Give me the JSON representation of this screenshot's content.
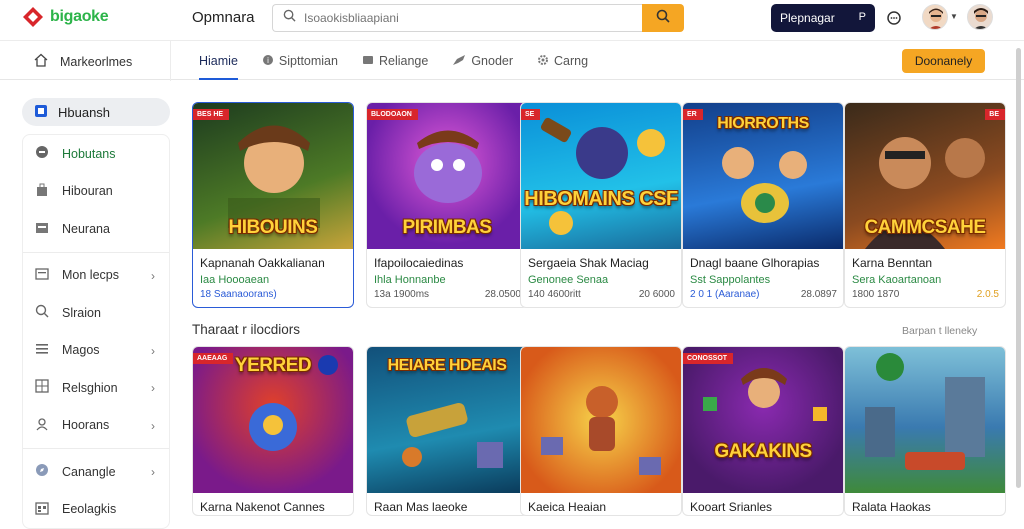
{
  "app": {
    "logo_text": "bigaoke",
    "title": "Opmnara"
  },
  "search": {
    "placeholder": "Isoaokisbliaapiani"
  },
  "header": {
    "promo_label": "Plepnagar",
    "promo_suffix": "P"
  },
  "nav": {
    "home_label": "Markeorlmes",
    "tabs": [
      {
        "label": "Hiamie",
        "icon": "none"
      },
      {
        "label": "Sipttomian",
        "icon": "circle-icon"
      },
      {
        "label": "Reliange",
        "icon": "square-icon"
      },
      {
        "label": "Gnoder",
        "icon": "hand-icon"
      },
      {
        "label": "Carng",
        "icon": "gear-icon"
      }
    ],
    "cta_label": "Doonanely"
  },
  "sidebar": {
    "head_label": "Hbuansh",
    "items": [
      {
        "label": "Hobutans",
        "icon": "gamepad-icon",
        "chevron": false
      },
      {
        "label": "Hibouran",
        "icon": "bag-icon",
        "chevron": false
      },
      {
        "label": "Neurana",
        "icon": "store-icon",
        "chevron": false
      },
      {
        "label": "Mon lecps",
        "icon": "image-icon",
        "chevron": true
      },
      {
        "label": "Slraion",
        "icon": "search-icon",
        "chevron": false
      },
      {
        "label": "Magos",
        "icon": "list-icon",
        "chevron": true
      },
      {
        "label": "Relsghion",
        "icon": "grid-icon",
        "chevron": true
      },
      {
        "label": "Hoorans",
        "icon": "user-icon",
        "chevron": true
      },
      {
        "label": "Canangle",
        "icon": "compass-icon",
        "chevron": true
      },
      {
        "label": "Eeolagkis",
        "icon": "calendar-icon",
        "chevron": false
      }
    ]
  },
  "section": {
    "title": "Tharaat r ilocdiors",
    "more": "Barpan t lleneky"
  },
  "games_row1": [
    {
      "badge": "BES HE",
      "art_title": "HIBOUINS",
      "title": "Kapnanah Oakkalianan",
      "sub": "Iaa Hoooaean",
      "meta_left": "18 Saanaoorans)",
      "meta_right": "",
      "colors": [
        "#1d3b1f",
        "#4d7a26",
        "#c9a43a"
      ]
    },
    {
      "badge": "BLODOAON",
      "art_title": "PIRIMBAS",
      "title": "Ifapoilocaiedinas",
      "sub": "Ihla Honnanbe",
      "meta_left": "13a 1900ms",
      "meta_right": "28.0500",
      "colors": [
        "#6a1fa8",
        "#c43ad6",
        "#f2c94c"
      ]
    },
    {
      "badge": "SE",
      "art_title": "HIBOMAINS CSF",
      "title": "Sergaeia Shak Maciag",
      "sub": "Genonee Senaa",
      "meta_left": "140 4600ritt",
      "meta_right": "20 6000",
      "colors": [
        "#0a8fd8",
        "#22c1e8",
        "#f2a42a"
      ]
    },
    {
      "badge": "ER",
      "art_title": "HIORROTHS",
      "title": "Dnagl baane Glhorapias",
      "sub": "Sst Sappolantes",
      "meta_left": "2 0 1 (Aaranae)",
      "meta_right": "28.0897",
      "colors": [
        "#123f8a",
        "#2a7ad8",
        "#e8c23a"
      ]
    },
    {
      "badge": "BE",
      "art_title": "CAMMCSAHE",
      "title": "Karna Benntan",
      "sub": "Sera Kaoartanoan",
      "meta_left": "1800 1870",
      "meta_right": "2.0.5",
      "colors": [
        "#3a2a1a",
        "#8a4a20",
        "#f07a20"
      ]
    }
  ],
  "games_row2": [
    {
      "badge": "AAEAAG",
      "art_title": "YERRED",
      "title": "Karna Nakenot Cannes",
      "colors": [
        "#7a1a8a",
        "#e0402a",
        "#f5c23a"
      ]
    },
    {
      "badge": "",
      "art_title": "HEIARE HDEAIS",
      "title": "Raan Mas laeoke",
      "colors": [
        "#12507a",
        "#1f8bb0",
        "#f2c94c"
      ]
    },
    {
      "badge": "",
      "art_title": "",
      "title": "Kaeica Heaian",
      "colors": [
        "#d85a1a",
        "#f2a42a",
        "#f7d34a"
      ]
    },
    {
      "badge": "CONOSSOT",
      "art_title": "GAKAKINS",
      "title": "Kooart Srianles",
      "colors": [
        "#4a1a6a",
        "#8a2ab0",
        "#f5b82a"
      ]
    },
    {
      "badge": "",
      "art_title": "",
      "title": "Ralata Haokas",
      "colors": [
        "#3a7ab0",
        "#7ec0d8",
        "#3f8a3a"
      ]
    }
  ]
}
